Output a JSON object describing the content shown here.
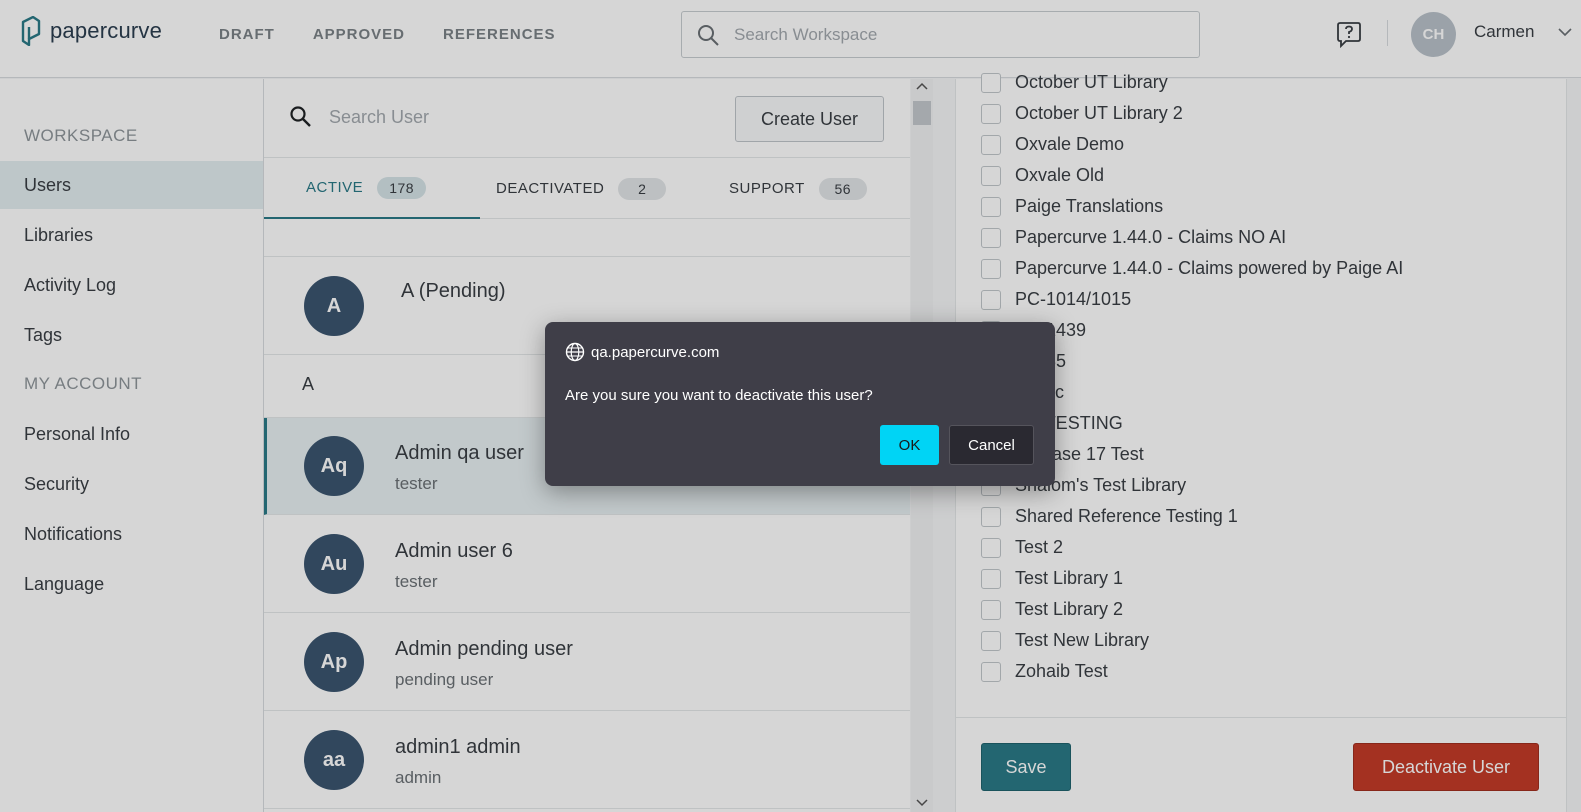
{
  "header": {
    "logo_text": "papercurve",
    "nav": [
      "DRAFT",
      "APPROVED",
      "REFERENCES"
    ],
    "search_placeholder": "Search Workspace",
    "avatar_initials": "CH",
    "user_name": "Carmen"
  },
  "sidebar": {
    "workspace_heading": "WORKSPACE",
    "workspace_items": [
      "Users",
      "Libraries",
      "Activity Log",
      "Tags"
    ],
    "account_heading": "MY ACCOUNT",
    "account_items": [
      "Personal Info",
      "Security",
      "Notifications",
      "Language"
    ],
    "active_item": "Users"
  },
  "users_panel": {
    "search_placeholder": "Search User",
    "create_button": "Create User",
    "tabs": [
      {
        "label": "ACTIVE",
        "count": "178"
      },
      {
        "label": "DEACTIVATED",
        "count": "2"
      },
      {
        "label": "SUPPORT",
        "count": "56"
      }
    ],
    "pending_user": {
      "initials": "A",
      "name": "A (Pending)"
    },
    "section_letter": "A",
    "users": [
      {
        "initials": "Aq",
        "name": "Admin qa user",
        "role": "tester"
      },
      {
        "initials": "Au",
        "name": "Admin user 6",
        "role": "tester"
      },
      {
        "initials": "Ap",
        "name": "Admin  pending user",
        "role": "pending user"
      },
      {
        "initials": "aa",
        "name": "admin1 admin",
        "role": "admin"
      }
    ]
  },
  "libraries_panel": {
    "libraries": [
      "October UT Library",
      "October UT Library 2",
      "Oxvale Demo",
      "Oxvale Old",
      "Paige Translations",
      "Papercurve 1.44.0 - Claims NO AI",
      "Papercurve 1.44.0 - Claims powered by Paige AI",
      "PC-1014/1015",
      "PC-1439",
      "PC-35",
      "Public",
      "QA TESTING",
      "Release 17 Test",
      "Shalom's Test Library",
      "Shared Reference Testing 1",
      "Test 2",
      "Test Library 1",
      "Test Library 2",
      "Test New Library",
      "Zohaib Test"
    ],
    "save_button": "Save",
    "deactivate_button": "Deactivate User"
  },
  "dialog": {
    "origin": "qa.papercurve.com",
    "message": "Are you sure you want to deactivate this user?",
    "ok_label": "OK",
    "cancel_label": "Cancel"
  },
  "colors": {
    "accent": "#2a7a87",
    "danger": "#c43b28",
    "dialog_bg": "#3f3e48",
    "ok_button": "#00d4f5",
    "avatar": "#3b556f"
  }
}
